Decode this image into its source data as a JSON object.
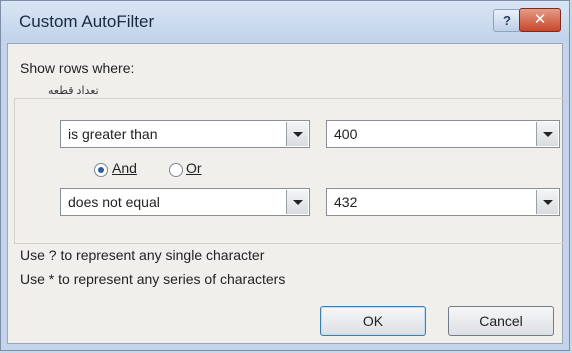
{
  "window": {
    "title": "Custom AutoFilter",
    "help": "?",
    "close": "✕"
  },
  "heading": "Show rows where:",
  "field_name": "تعداد قطعه",
  "condition1": {
    "operator": "is greater than",
    "value": "400"
  },
  "logic": {
    "and_label": "And",
    "or_label": "Or",
    "selected": "And"
  },
  "condition2": {
    "operator": "does not equal",
    "value": "432"
  },
  "hints": [
    "Use ? to represent any single character",
    "Use * to represent any series of characters"
  ],
  "buttons": {
    "ok": "OK",
    "cancel": "Cancel"
  }
}
